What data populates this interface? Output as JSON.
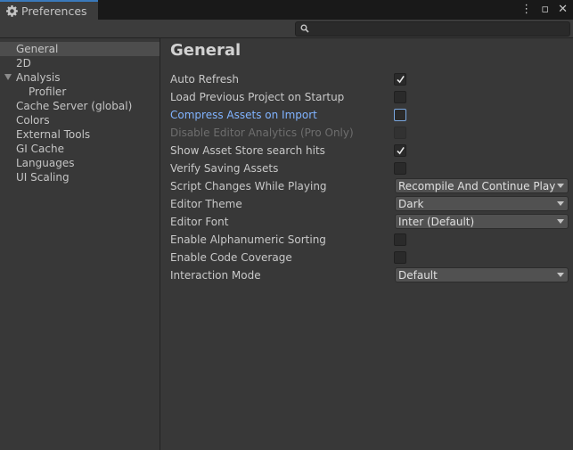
{
  "window": {
    "tab_title": "Preferences",
    "tab_icon": "gear-icon",
    "menu_icon": "kebab-menu-icon",
    "maximize_icon": "maximize-icon",
    "close_icon": "close-icon"
  },
  "search": {
    "placeholder": "",
    "icon": "search-icon"
  },
  "sidebar": {
    "items": [
      {
        "label": "General",
        "selected": true
      },
      {
        "label": "2D"
      },
      {
        "label": "Analysis",
        "expanded": true
      },
      {
        "label": "Profiler",
        "child": true
      },
      {
        "label": "Cache Server (global)"
      },
      {
        "label": "Colors"
      },
      {
        "label": "External Tools"
      },
      {
        "label": "GI Cache"
      },
      {
        "label": "Languages"
      },
      {
        "label": "UI Scaling"
      }
    ]
  },
  "main": {
    "title": "General",
    "settings": [
      {
        "label": "Auto Refresh",
        "type": "checkbox",
        "checked": true
      },
      {
        "label": "Load Previous Project on Startup",
        "type": "checkbox",
        "checked": false
      },
      {
        "label": "Compress Assets on Import",
        "type": "checkbox",
        "checked": false,
        "focused": true
      },
      {
        "label": "Disable Editor Analytics (Pro Only)",
        "type": "checkbox",
        "checked": false,
        "disabled": true
      },
      {
        "label": "Show Asset Store search hits",
        "type": "checkbox",
        "checked": true
      },
      {
        "label": "Verify Saving Assets",
        "type": "checkbox",
        "checked": false
      },
      {
        "label": "Script Changes While Playing",
        "type": "dropdown",
        "value": "Recompile And Continue Playin"
      },
      {
        "label": "Editor Theme",
        "type": "dropdown",
        "value": "Dark"
      },
      {
        "label": "Editor Font",
        "type": "dropdown",
        "value": "Inter (Default)"
      },
      {
        "label": "Enable Alphanumeric Sorting",
        "type": "checkbox",
        "checked": false
      },
      {
        "label": "Enable Code Coverage",
        "type": "checkbox",
        "checked": false
      },
      {
        "label": "Interaction Mode",
        "type": "dropdown",
        "value": "Default"
      }
    ]
  },
  "colors": {
    "background": "#383838",
    "tab_accent": "#3a79bb",
    "focus_label": "#80b3ff",
    "selection": "#4d4d4d"
  }
}
